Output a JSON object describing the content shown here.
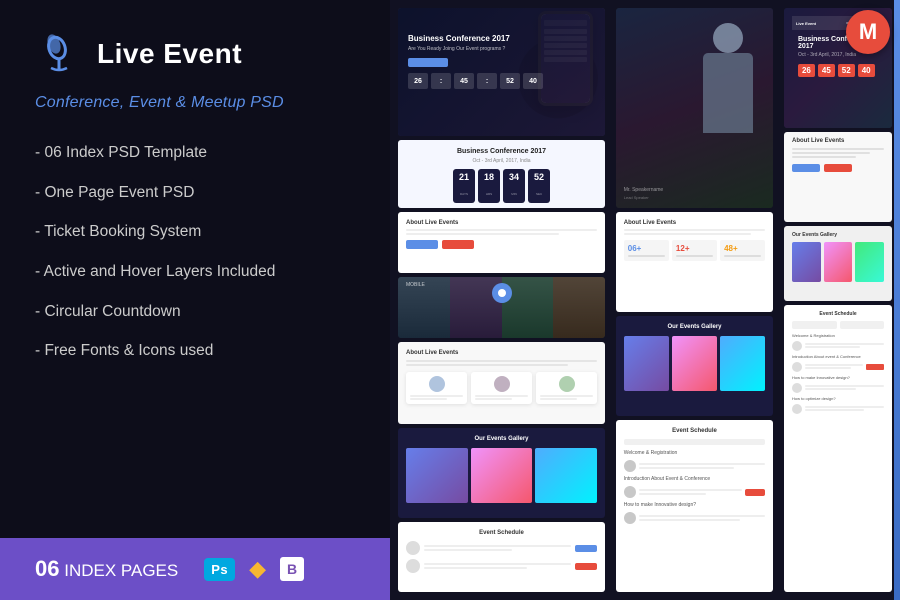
{
  "app": {
    "title": "Live Event",
    "subtitle": "Conference, Event & Meetup PSD"
  },
  "features": [
    "- 06 Index PSD Template",
    "- One Page Event PSD",
    "- Ticket Booking System",
    "- Active and Hover Layers Included",
    "- Circular Countdown",
    "- Free Fonts & Icons used"
  ],
  "bottom_bar": {
    "label": "INDEX PAGES",
    "count": "06"
  },
  "conference": {
    "title": "Business Conference 2017",
    "subtitle": "Are You Ready Joing Our Event programs ?",
    "date": "Oct - 3rd April, 2017, India",
    "countdown": {
      "days": "26",
      "hours": "45",
      "minutes": "52",
      "seconds": "40"
    }
  },
  "icons": {
    "microphone": "🎤",
    "photoshop": "Ps",
    "sketch": "◆",
    "bootstrap": "B",
    "envato": "M"
  },
  "colors": {
    "primary": "#5b8ee6",
    "accent": "#6c4fc7",
    "red": "#e74c3c",
    "dark": "#0d0d1a",
    "white": "#ffffff"
  }
}
